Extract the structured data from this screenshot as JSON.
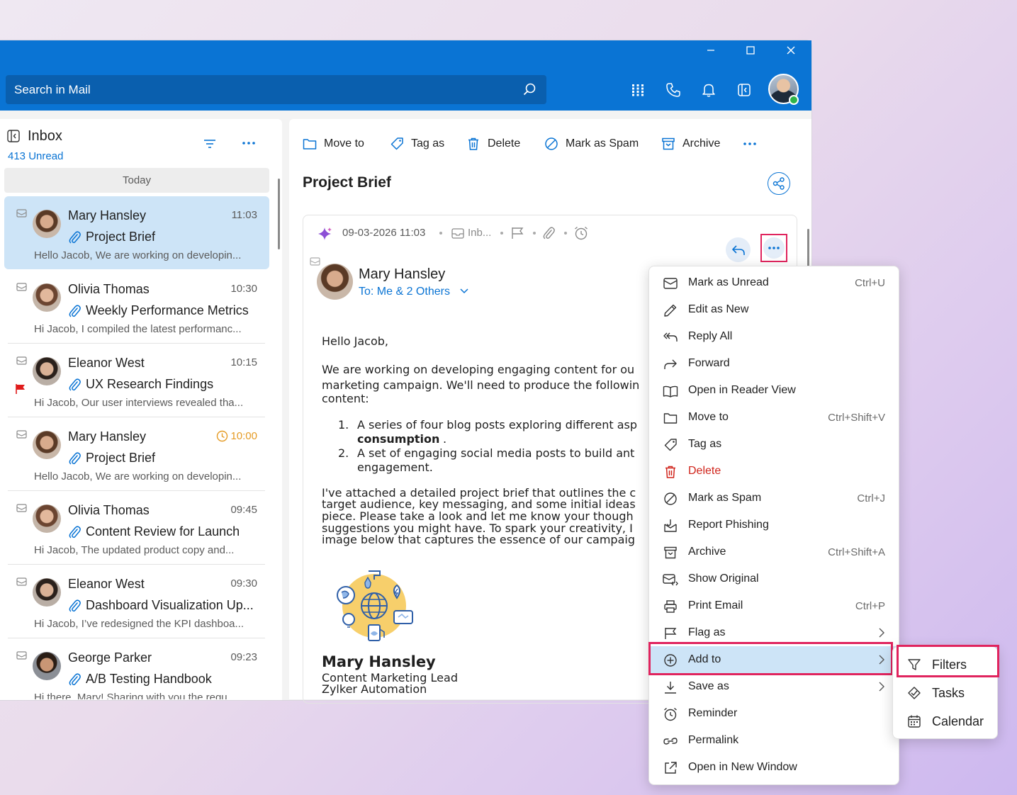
{
  "search": {
    "placeholder": "Search in Mail"
  },
  "inbox": {
    "title": "Inbox",
    "unread": "413 Unread",
    "group": "Today"
  },
  "messages": [
    {
      "sender": "Mary Hansley",
      "time": "11:03",
      "subject": "Project Brief",
      "preview": "Hello Jacob, We are working on developin..."
    },
    {
      "sender": "Olivia Thomas",
      "time": "10:30",
      "subject": "Weekly Performance Metrics",
      "preview": "Hi Jacob, I compiled the latest performanc..."
    },
    {
      "sender": "Eleanor West",
      "time": "10:15",
      "subject": "UX Research Findings",
      "preview": "Hi Jacob, Our user interviews revealed tha..."
    },
    {
      "sender": "Mary Hansley",
      "time": "10:00",
      "subject": "Project Brief",
      "preview": "Hello Jacob, We are working on developin..."
    },
    {
      "sender": "Olivia Thomas",
      "time": "09:45",
      "subject": "Content Review for Launch",
      "preview": "Hi Jacob, The updated product copy and..."
    },
    {
      "sender": "Eleanor West",
      "time": "09:30",
      "subject": "Dashboard Visualization Up...",
      "preview": "Hi Jacob, I’ve redesigned the KPI dashboa..."
    },
    {
      "sender": "George Parker",
      "time": "09:23",
      "subject": "A/B Testing Handbook",
      "preview": "Hi there, Mary! Sharing with you the requ..."
    }
  ],
  "toolbar": {
    "move_to": "Move to",
    "tag_as": "Tag as",
    "delete": "Delete",
    "mark_spam": "Mark as Spam",
    "archive": "Archive"
  },
  "email": {
    "subject": "Project Brief",
    "date": "09-03-2026 11:03",
    "folder": "Inb...",
    "from": "Mary Hansley",
    "to": "To: Me & 2 Others",
    "greeting": "Hello Jacob,",
    "para1_l1": "We are working on developing engaging content for ou",
    "para1_l2": "marketing campaign. We'll need to produce the followin",
    "para1_l3": "content:",
    "li1_num": "1.",
    "li1_a": "A series of four blog posts exploring different asp",
    "li1_b": "consumption",
    "li1_b_end": ".",
    "li2_num": "2.",
    "li2_a": "A set of engaging social media posts to build ant",
    "li2_b": "engagement.",
    "para2_l1": "I've attached a detailed project brief that outlines the c",
    "para2_l2": "target audience, key messaging, and some initial ideas",
    "para2_l3": "piece. Please take a look and let me know your though",
    "para2_l4": "suggestions you might have. To spark your creativity, I",
    "para2_l5": "image below that captures the essence of our campaig",
    "sig_name": "Mary Hansley",
    "sig_title": "Content Marketing Lead",
    "sig_company": "Zylker Automation"
  },
  "menu": [
    {
      "label": "Mark as Unread",
      "shortcut": "Ctrl+U"
    },
    {
      "label": "Edit as New",
      "shortcut": ""
    },
    {
      "label": "Reply All",
      "shortcut": ""
    },
    {
      "label": "Forward",
      "shortcut": ""
    },
    {
      "label": "Open in Reader View",
      "shortcut": ""
    },
    {
      "label": "Move to",
      "shortcut": "Ctrl+Shift+V"
    },
    {
      "label": "Tag as",
      "shortcut": ""
    },
    {
      "label": "Delete",
      "shortcut": ""
    },
    {
      "label": "Mark as Spam",
      "shortcut": "Ctrl+J"
    },
    {
      "label": "Report Phishing",
      "shortcut": ""
    },
    {
      "label": "Archive",
      "shortcut": "Ctrl+Shift+A"
    },
    {
      "label": "Show Original",
      "shortcut": ""
    },
    {
      "label": "Print Email",
      "shortcut": "Ctrl+P"
    },
    {
      "label": "Flag as",
      "shortcut": ""
    },
    {
      "label": "Add to",
      "shortcut": ""
    },
    {
      "label": "Save as",
      "shortcut": ""
    },
    {
      "label": "Reminder",
      "shortcut": ""
    },
    {
      "label": "Permalink",
      "shortcut": ""
    },
    {
      "label": "Open in New Window",
      "shortcut": ""
    }
  ],
  "submenu": [
    {
      "label": "Filters"
    },
    {
      "label": "Tasks"
    },
    {
      "label": "Calendar"
    }
  ],
  "colors": {
    "accent": "#0a74d4",
    "highlight": "#e0245e",
    "selected": "#cde4f7",
    "danger": "#d0241b",
    "reminder": "#e59b24"
  }
}
